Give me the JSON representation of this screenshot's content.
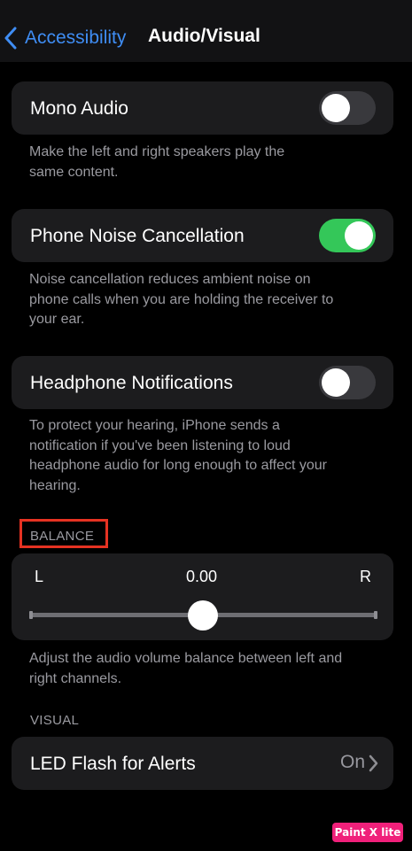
{
  "nav": {
    "back_label": "Accessibility",
    "title": "Audio/Visual"
  },
  "mono_audio": {
    "label": "Mono Audio",
    "enabled": false,
    "footnote_lines": [
      "Make the left and right speakers play the",
      "same content."
    ]
  },
  "noise_cancellation": {
    "label": "Phone Noise Cancellation",
    "enabled": true,
    "footnote_lines": [
      "Noise cancellation reduces ambient noise on",
      "phone calls when you are holding the receiver to",
      "your ear."
    ]
  },
  "headphone_notifications": {
    "label": "Headphone Notifications",
    "enabled": false,
    "footnote_lines": [
      "To protect your hearing, iPhone sends a",
      "notification if you've been listening to loud",
      "headphone audio for long enough to affect your",
      "hearing."
    ]
  },
  "balance": {
    "header": "BALANCE",
    "left_label": "L",
    "right_label": "R",
    "value": "0.00",
    "footnote_lines": [
      "Adjust the audio volume balance between left and",
      "right channels."
    ]
  },
  "visual": {
    "header": "VISUAL",
    "led_flash": {
      "label": "LED Flash for Alerts",
      "value": "On"
    }
  },
  "watermark": {
    "text": "Paint X lite"
  },
  "colors": {
    "accent": "#3f8df4",
    "toggle_on": "#34c759",
    "toggle_off": "#39393d",
    "highlight": "#e53222"
  },
  "icons": {
    "back": "chevron-left-icon",
    "disclosure": "chevron-right-icon"
  }
}
